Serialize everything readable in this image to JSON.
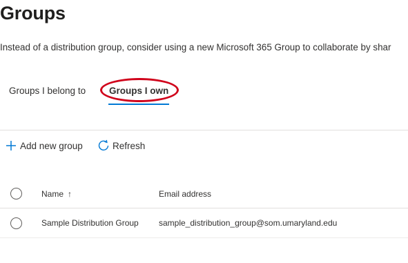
{
  "page": {
    "title": "Groups",
    "description": "Instead of a distribution group, consider using a new Microsoft 365 Group to collaborate by shar"
  },
  "tabs": [
    {
      "label": "Groups I belong to",
      "selected": false
    },
    {
      "label": "Groups I own",
      "selected": true
    }
  ],
  "commands": {
    "add_label": "Add new group",
    "refresh_label": "Refresh"
  },
  "table": {
    "columns": [
      "Name",
      "Email address"
    ],
    "sort_indicator": "↑",
    "rows": [
      {
        "name": "Sample Distribution Group",
        "email": "sample_distribution_group@som.umaryland.edu"
      }
    ]
  },
  "colors": {
    "accent": "#0078d4",
    "highlight": "#d0021b"
  },
  "icons": {
    "add": "plus-icon",
    "refresh": "refresh-icon",
    "sort": "arrow-up-icon"
  }
}
